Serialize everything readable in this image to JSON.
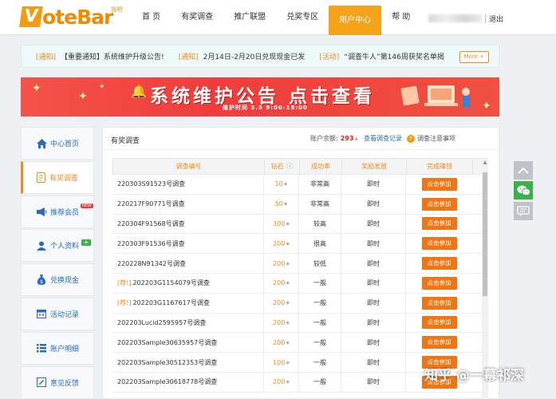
{
  "header": {
    "logo_text": "oteBar",
    "logo_letter": "V",
    "logo_sup": "投吧",
    "nav": [
      "首 页",
      "有奖调查",
      "推广联盟",
      "兑奖专区",
      "用户中心",
      "帮 助"
    ],
    "logout": "退出"
  },
  "notices": [
    {
      "tag": "[通知]",
      "text": "【重要通知】系统维护升级公告!"
    },
    {
      "tag": "[通知]",
      "text": "2月14日-2月20日兑现现金已发"
    },
    {
      "tag": "[活动]",
      "text": "“调查牛人”第146周获奖名单揭"
    }
  ],
  "notice_more": "More +",
  "banner": {
    "title": "系统维护公告   点击查看",
    "subtitle": "维护时间 3.5 9:00-18:00"
  },
  "sidebar": {
    "items": [
      {
        "label": "中心首页",
        "icon": "home-icon"
      },
      {
        "label": "有奖调查",
        "icon": "survey-icon"
      },
      {
        "label": "推荐会员",
        "icon": "megaphone-icon",
        "badge": "NEW"
      },
      {
        "label": "个人资料",
        "icon": "user-icon",
        "badge": "+"
      },
      {
        "label": "兑换现金",
        "icon": "money-bag-icon"
      },
      {
        "label": "活动记录",
        "icon": "calendar-icon"
      },
      {
        "label": "账户明细",
        "icon": "list-icon"
      },
      {
        "label": "意见反馈",
        "icon": "feedback-icon"
      }
    ]
  },
  "main": {
    "title": "有奖调查",
    "balance_label": "账户余额:",
    "balance_value": "293",
    "record_link": "查看调查记录",
    "notes_link": "调查注意事项",
    "columns": [
      "调查编号",
      "钻石",
      "成功率",
      "奖励发放",
      "完成赚钱"
    ],
    "join_label": "点击参加",
    "rows": [
      {
        "prefix": "",
        "id": "220303S91523号调查",
        "diamonds": "10",
        "rate": "非常高",
        "reward": "即时"
      },
      {
        "prefix": "",
        "id": "220217F90771号调查",
        "diamonds": "50",
        "rate": "非常高",
        "reward": "即时"
      },
      {
        "prefix": "",
        "id": "220304F91568号调查",
        "diamonds": "300",
        "rate": "较高",
        "reward": "即时"
      },
      {
        "prefix": "",
        "id": "220303F91536号调查",
        "diamonds": "200",
        "rate": "很高",
        "reward": "即时"
      },
      {
        "prefix": "",
        "id": "220228N91342号调查",
        "diamonds": "200",
        "rate": "较低",
        "reward": "即时"
      },
      {
        "prefix": "[荐!]",
        "id": "202203G1154079号调查",
        "diamonds": "200",
        "rate": "一般",
        "reward": "即时"
      },
      {
        "prefix": "[荐!]",
        "id": "202203G1167617号调查",
        "diamonds": "200",
        "rate": "一般",
        "reward": "即时"
      },
      {
        "prefix": "",
        "id": "202203Lucid2595957号调查",
        "diamonds": "200",
        "rate": "一般",
        "reward": "即时"
      },
      {
        "prefix": "",
        "id": "202203Sample30635957号调查",
        "diamonds": "200",
        "rate": "一般",
        "reward": "即时"
      },
      {
        "prefix": "",
        "id": "202203Sample30512353号调查",
        "diamonds": "100",
        "rate": "一般",
        "reward": "即时"
      },
      {
        "prefix": "",
        "id": "202203Sample30618778号调查",
        "diamonds": "200",
        "rate": "一般",
        "reward": "即时"
      }
    ]
  },
  "watermark": "知乎 @一幕祁深",
  "colors": {
    "accent": "#f08a1e",
    "button": "#f17613",
    "link": "#2b6cb8",
    "banner": "#ef3d3d"
  }
}
